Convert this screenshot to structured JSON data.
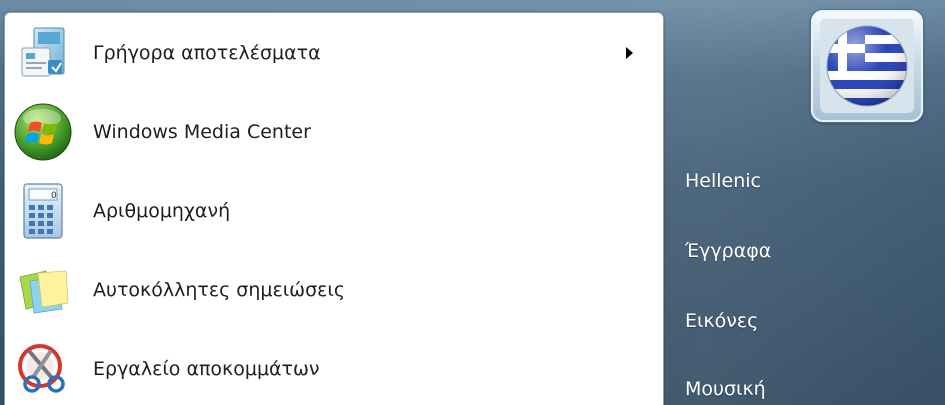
{
  "programs": [
    {
      "label": "Γρήγορα αποτελέσματα",
      "icon": "getting-started-icon",
      "has_submenu": true
    },
    {
      "label": "Windows Media Center",
      "icon": "windows-media-center-icon",
      "has_submenu": false
    },
    {
      "label": "Αριθμομηχανή",
      "icon": "calculator-icon",
      "has_submenu": false
    },
    {
      "label": "Αυτοκόλλητες σημειώσεις",
      "icon": "sticky-notes-icon",
      "has_submenu": false
    },
    {
      "label": "Εργαλείο αποκομμάτων",
      "icon": "snipping-tool-icon",
      "has_submenu": false
    }
  ],
  "user_tile": {
    "icon": "greek-flag-icon"
  },
  "places": [
    {
      "label": "Hellenic"
    },
    {
      "label": "Έγγραφα"
    },
    {
      "label": "Εικόνες"
    },
    {
      "label": "Μουσική"
    }
  ],
  "colors": {
    "pane_background": "#ffffff",
    "right_pane_top": "#6b8aa3",
    "right_pane_bottom": "#334c62",
    "text_dark": "#1e1e1e",
    "text_light": "#ffffff",
    "flag_blue": "#1d3bb5"
  }
}
